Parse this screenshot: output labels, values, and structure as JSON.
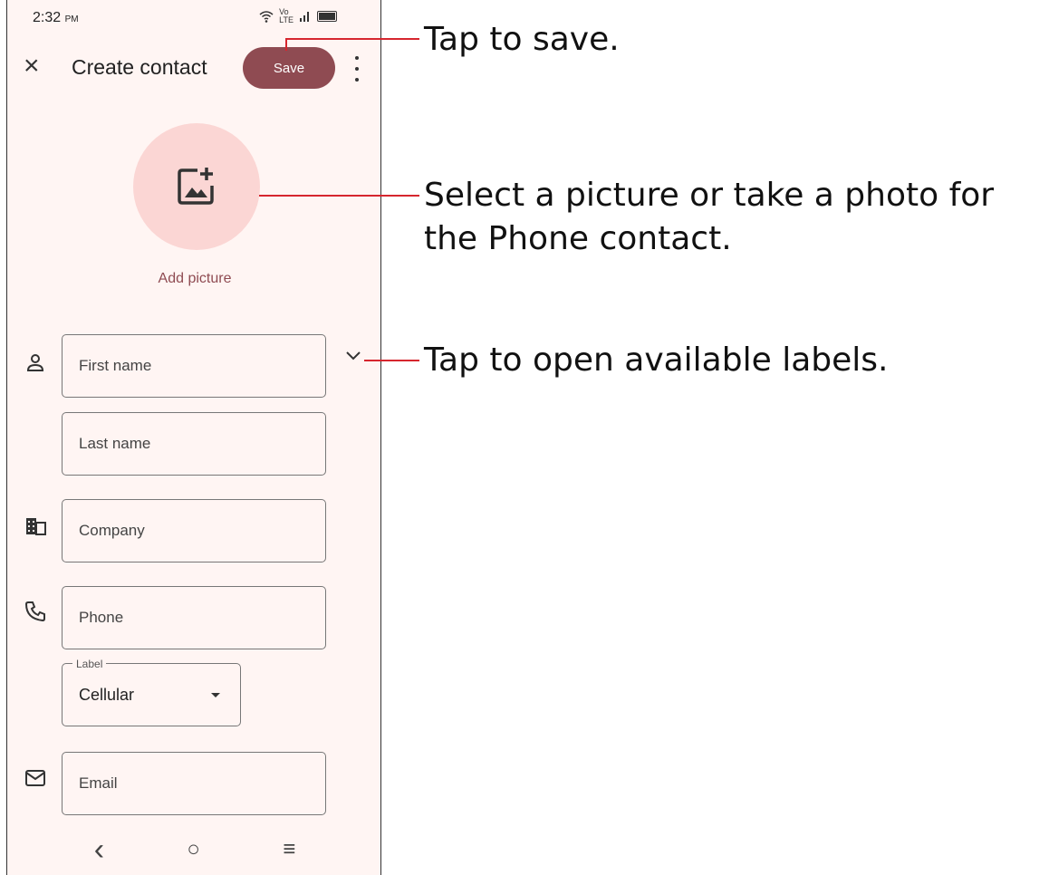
{
  "status_bar": {
    "time": "2:32",
    "ampm": "PM",
    "network_top": "Vo",
    "network_bottom": "LTE"
  },
  "header": {
    "title": "Create contact",
    "save_label": "Save"
  },
  "photo": {
    "add_label": "Add picture"
  },
  "fields": {
    "first_name_placeholder": "First name",
    "last_name_placeholder": "Last name",
    "company_placeholder": "Company",
    "phone_placeholder": "Phone",
    "phone_label_caption": "Label",
    "phone_label_value": "Cellular",
    "email_placeholder": "Email"
  },
  "navbar": {
    "back": "‹",
    "home": "○",
    "menu": "≡"
  },
  "callouts": {
    "save": "Tap to save.",
    "picture": "Select a picture or take a photo for the Phone contact.",
    "labels": "Tap to open available labels."
  },
  "colors": {
    "accent": "#8f4b52",
    "avatar_bg": "#fbd6d4",
    "callout_line": "#d6262e",
    "screen_bg": "#fff5f3"
  }
}
